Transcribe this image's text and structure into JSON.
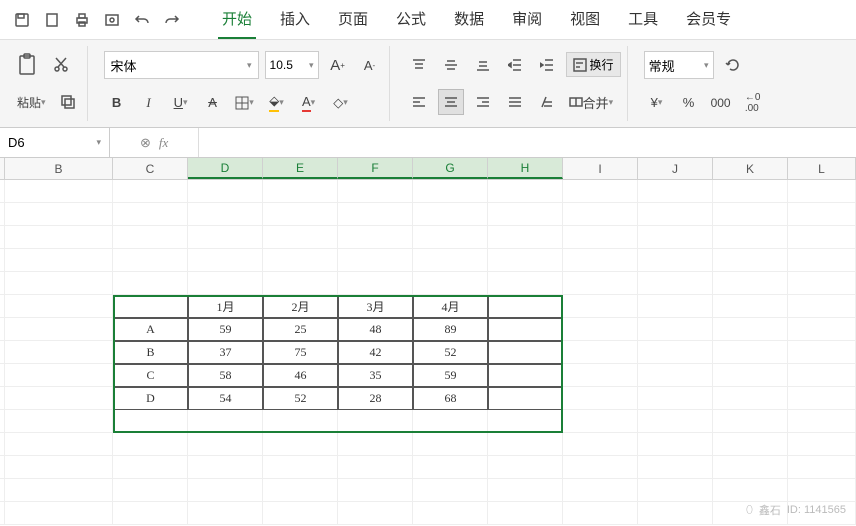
{
  "menu": {
    "tabs": [
      "开始",
      "插入",
      "页面",
      "公式",
      "数据",
      "审阅",
      "视图",
      "工具",
      "会员专"
    ],
    "active_index": 0
  },
  "ribbon": {
    "paste_label": "粘贴",
    "font_name": "宋体",
    "font_size": "10.5",
    "bold": "B",
    "italic": "I",
    "underline": "U",
    "strike": "A",
    "wrap_label": "换行",
    "merge_label": "合并",
    "num_format": "常规",
    "currency": "¥",
    "percent": "%",
    "thousand": "000",
    "decimals": "←0 .00"
  },
  "namebox": "D6",
  "fx": "fx",
  "columns": [
    "",
    "B",
    "C",
    "D",
    "E",
    "F",
    "G",
    "H",
    "I",
    "J",
    "K",
    "L"
  ],
  "selected_cols": [
    "D",
    "E",
    "F",
    "G",
    "H"
  ],
  "chart_data": {
    "type": "table",
    "note": "Spreadsheet cell values in range C13:H18",
    "col_headers": [
      "",
      "1月",
      "2月",
      "3月",
      "4月"
    ],
    "rows": [
      {
        "label": "A",
        "values": [
          59,
          25,
          48,
          89
        ]
      },
      {
        "label": "B",
        "values": [
          37,
          75,
          42,
          52
        ]
      },
      {
        "label": "C",
        "values": [
          58,
          46,
          35,
          59
        ]
      },
      {
        "label": "D",
        "values": [
          54,
          52,
          28,
          68
        ]
      }
    ]
  },
  "watermark": {
    "brand": "鑫石",
    "id": "ID: 1141565"
  }
}
